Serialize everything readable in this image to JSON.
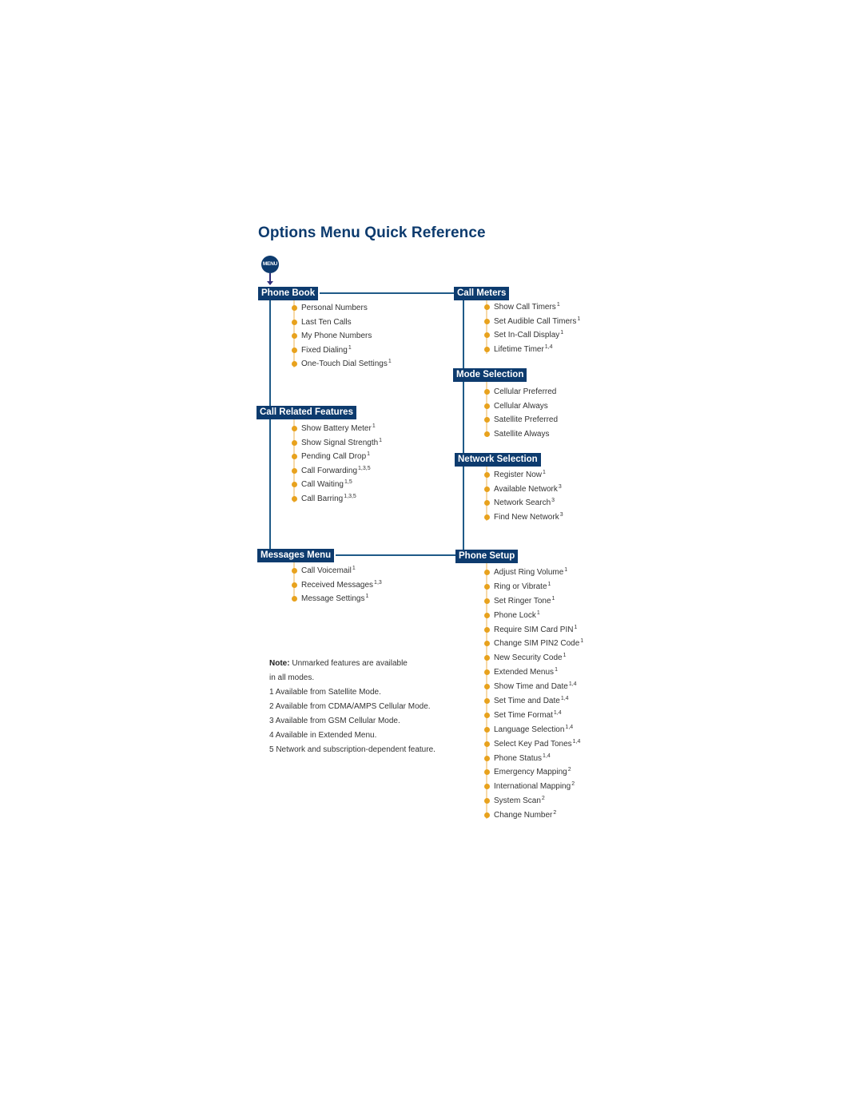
{
  "title": "Options Menu Quick Reference",
  "menu_button_label": "MENU",
  "colors": {
    "header_bg": "#0d3b6e",
    "bullet": "#e8a21d",
    "connector": "#1f5a88",
    "item_line": "#f7d9a8"
  },
  "sections": {
    "phone_book": {
      "label": "Phone Book",
      "items": [
        {
          "text": "Personal Numbers",
          "sup": ""
        },
        {
          "text": "Last Ten Calls",
          "sup": ""
        },
        {
          "text": "My Phone Numbers",
          "sup": ""
        },
        {
          "text": "Fixed Dialing",
          "sup": "1"
        },
        {
          "text": "One-Touch Dial Settings",
          "sup": "1"
        }
      ]
    },
    "call_related": {
      "label": "Call Related Features",
      "items": [
        {
          "text": "Show Battery Meter",
          "sup": "1"
        },
        {
          "text": "Show Signal Strength",
          "sup": "1"
        },
        {
          "text": "Pending Call Drop",
          "sup": "1"
        },
        {
          "text": "Call Forwarding",
          "sup": "1,3,5"
        },
        {
          "text": "Call Waiting",
          "sup": "1,5"
        },
        {
          "text": "Call Barring",
          "sup": "1,3,5"
        }
      ]
    },
    "messages": {
      "label": "Messages Menu",
      "items": [
        {
          "text": "Call Voicemail",
          "sup": "1"
        },
        {
          "text": "Received Messages",
          "sup": "1,3"
        },
        {
          "text": "Message Settings",
          "sup": "1"
        }
      ]
    },
    "call_meters": {
      "label": "Call Meters",
      "items": [
        {
          "text": "Show Call Timers",
          "sup": "1"
        },
        {
          "text": "Set Audible Call Timers",
          "sup": "1"
        },
        {
          "text": "Set In-Call Display",
          "sup": "1"
        },
        {
          "text": "Lifetime Timer",
          "sup": "1,4"
        }
      ]
    },
    "mode_selection": {
      "label": "Mode Selection",
      "items": [
        {
          "text": "Cellular Preferred",
          "sup": ""
        },
        {
          "text": "Cellular Always",
          "sup": ""
        },
        {
          "text": "Satellite Preferred",
          "sup": ""
        },
        {
          "text": "Satellite Always",
          "sup": ""
        }
      ]
    },
    "network_selection": {
      "label": "Network Selection",
      "items": [
        {
          "text": "Register Now",
          "sup": "1"
        },
        {
          "text": "Available Network",
          "sup": "3"
        },
        {
          "text": "Network Search",
          "sup": "3"
        },
        {
          "text": "Find New Network",
          "sup": "3"
        }
      ]
    },
    "phone_setup": {
      "label": "Phone Setup",
      "items": [
        {
          "text": "Adjust Ring Volume",
          "sup": "1"
        },
        {
          "text": "Ring or Vibrate",
          "sup": "1"
        },
        {
          "text": "Set Ringer Tone",
          "sup": "1"
        },
        {
          "text": "Phone Lock",
          "sup": "1"
        },
        {
          "text": "Require SIM Card PIN",
          "sup": "1"
        },
        {
          "text": "Change SIM PIN2 Code",
          "sup": "1"
        },
        {
          "text": "New Security Code",
          "sup": "1"
        },
        {
          "text": "Extended Menus",
          "sup": "1"
        },
        {
          "text": "Show Time and Date",
          "sup": "1,4"
        },
        {
          "text": "Set Time and Date",
          "sup": "1,4"
        },
        {
          "text": "Set Time Format",
          "sup": "1,4"
        },
        {
          "text": "Language Selection",
          "sup": "1,4"
        },
        {
          "text": "Select Key Pad Tones",
          "sup": "1,4"
        },
        {
          "text": "Phone Status",
          "sup": "1,4"
        },
        {
          "text": "Emergency Mapping",
          "sup": "2"
        },
        {
          "text": "International Mapping",
          "sup": "2"
        },
        {
          "text": "System Scan",
          "sup": "2"
        },
        {
          "text": "Change Number",
          "sup": "2"
        }
      ]
    }
  },
  "notes": {
    "note_label": "Note:",
    "note_text": " Unmarked features are available",
    "note_text_2": "in all modes.",
    "footnotes": [
      "1 Available from Satellite Mode.",
      "2 Available from CDMA/AMPS Cellular Mode.",
      "3 Available from GSM Cellular Mode.",
      "4 Available in Extended Menu.",
      "5 Network and subscription-dependent feature."
    ]
  }
}
